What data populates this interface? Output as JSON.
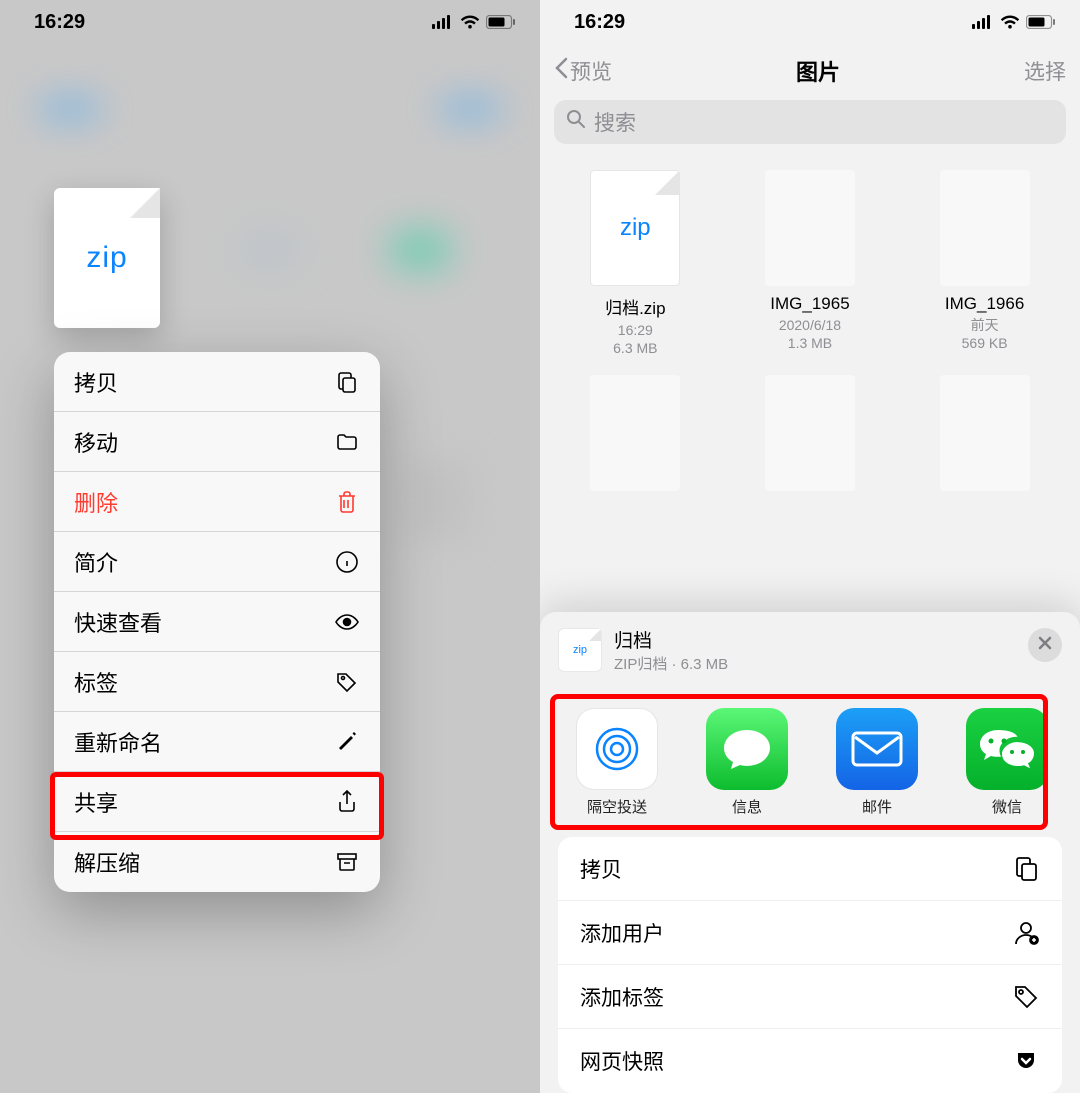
{
  "status": {
    "time": "16:29"
  },
  "left": {
    "zip_label": "zip",
    "menu": [
      {
        "key": "copy",
        "label": "拷贝"
      },
      {
        "key": "move",
        "label": "移动"
      },
      {
        "key": "delete",
        "label": "删除"
      },
      {
        "key": "info",
        "label": "简介"
      },
      {
        "key": "quicklook",
        "label": "快速查看"
      },
      {
        "key": "tags",
        "label": "标签"
      },
      {
        "key": "rename",
        "label": "重新命名"
      },
      {
        "key": "share",
        "label": "共享"
      },
      {
        "key": "uncompress",
        "label": "解压缩"
      }
    ]
  },
  "right": {
    "nav": {
      "back": "预览",
      "title": "图片",
      "select": "选择"
    },
    "search_placeholder": "搜索",
    "files": [
      {
        "name": "归档.zip",
        "line1": "16:29",
        "line2": "6.3 MB",
        "kind": "zip"
      },
      {
        "name": "IMG_1965",
        "line1": "2020/6/18",
        "line2": "1.3 MB",
        "kind": "img"
      },
      {
        "name": "IMG_1966",
        "line1": "前天",
        "line2": "569 KB",
        "kind": "img"
      }
    ],
    "sheet": {
      "title": "归档",
      "subtitle": "ZIP归档 · 6.3 MB",
      "thumb_label": "zip",
      "apps": [
        {
          "key": "airdrop",
          "label": "隔空投送"
        },
        {
          "key": "messages",
          "label": "信息"
        },
        {
          "key": "mail",
          "label": "邮件"
        },
        {
          "key": "wechat",
          "label": "微信"
        }
      ],
      "actions": [
        {
          "key": "copy",
          "label": "拷贝"
        },
        {
          "key": "adduser",
          "label": "添加用户"
        },
        {
          "key": "addtags",
          "label": "添加标签"
        },
        {
          "key": "websnap",
          "label": "网页快照"
        }
      ]
    }
  }
}
